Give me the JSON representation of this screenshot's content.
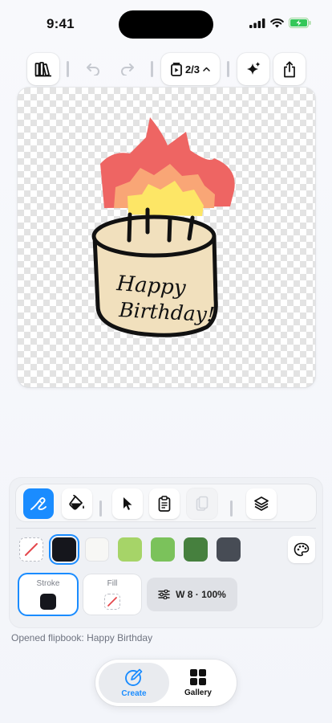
{
  "status_bar": {
    "time": "9:41",
    "icons": [
      "signal-icon",
      "wifi-icon",
      "battery-charging-icon"
    ]
  },
  "toolbar": {
    "buttons": [
      "library-icon",
      "undo-icon",
      "redo-icon",
      "page-selector",
      "sparkle-icon",
      "share-icon"
    ],
    "page_indicator": "2/3"
  },
  "canvas": {
    "drawing_text_line1": "Happy",
    "drawing_text_line2": "Birthday!"
  },
  "tools": {
    "items": [
      "pen-tool",
      "fill-bucket-tool",
      "select-arrow-tool",
      "paste-tool",
      "copy-tool",
      "layers-tool"
    ],
    "active": "pen-tool",
    "disabled": [
      "copy-tool"
    ]
  },
  "swatches": {
    "colors": [
      "none",
      "#15161c",
      "#f7f7f5",
      "#a6d468",
      "#7bc25b",
      "#46803e",
      "#474c55"
    ],
    "selected_index": 1
  },
  "stroke_fill": {
    "stroke_label": "Stroke",
    "stroke_color": "#15161c",
    "fill_label": "Fill",
    "fill_color": "none"
  },
  "brush": {
    "settings_label": "W 8 · 100%"
  },
  "status_message": "Opened flipbook: Happy Birthday",
  "tabbar": {
    "create_label": "Create",
    "gallery_label": "Gallery",
    "active": "create"
  },
  "colors": {
    "accent": "#1a8cff",
    "flame_outer": "#ee6563",
    "flame_mid": "#f9a676",
    "flame_inner": "#fde666",
    "cake": "#f1e0bd"
  }
}
